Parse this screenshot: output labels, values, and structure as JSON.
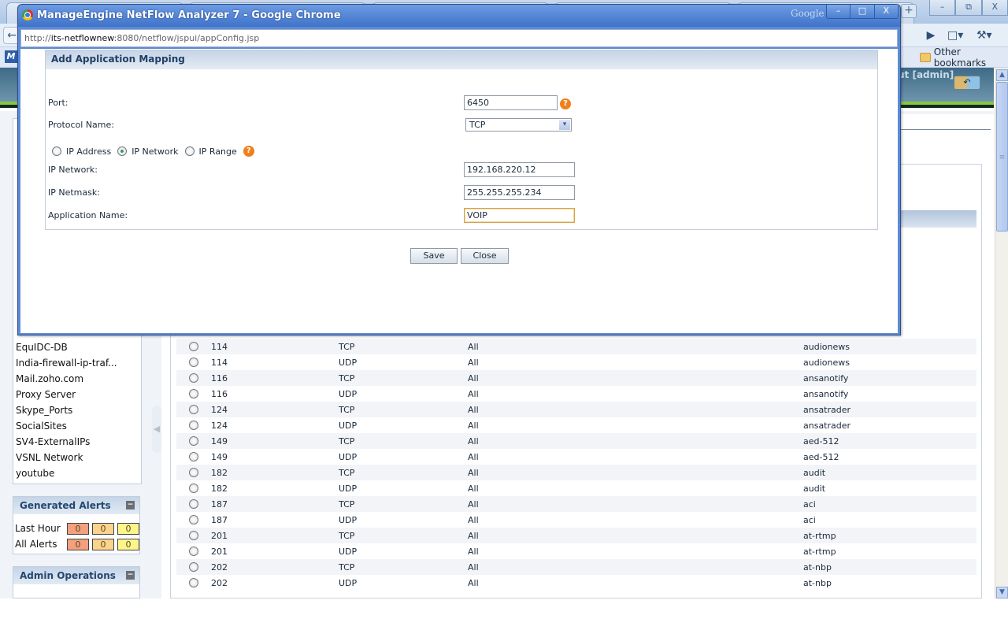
{
  "browser": {
    "other_bookmarks": "Other bookmarks",
    "new_tab_glyph": "+",
    "back_glyph": "←",
    "go_glyph": "▶",
    "page_menu_glyph": "□▾",
    "wrench_glyph": "⚒▾",
    "window_buttons": [
      "–",
      "⧉",
      "X"
    ],
    "m_logo": "M"
  },
  "app": {
    "user_label": "ut [admin]",
    "logout_glyph": "↶",
    "left_list": [
      "EquIDC-DB",
      "India-firewall-ip-traf...",
      "Mail.zoho.com",
      "Proxy Server",
      "Skype_Ports",
      "SocialSites",
      "SV4-ExternalIPs",
      "VSNL Network",
      "youtube"
    ],
    "alerts_panel": {
      "title": "Generated Alerts",
      "rows": [
        {
          "label": "Last Hour",
          "critical": "0",
          "major": "0",
          "warning": "0"
        },
        {
          "label": "All Alerts",
          "critical": "0",
          "major": "0",
          "warning": "0"
        }
      ]
    },
    "admin_panel": {
      "title": "Admin Operations"
    },
    "collapse_glyph": "−",
    "splitter_glyph": "◀",
    "alert_colors": {
      "critical": "#f4a07c",
      "major": "#fbd38a",
      "warning": "#fdf58a"
    },
    "rows": [
      {
        "port": "114",
        "protocol": "TCP",
        "ip": "All",
        "app": "audionews"
      },
      {
        "port": "114",
        "protocol": "UDP",
        "ip": "All",
        "app": "audionews"
      },
      {
        "port": "116",
        "protocol": "TCP",
        "ip": "All",
        "app": "ansanotify"
      },
      {
        "port": "116",
        "protocol": "UDP",
        "ip": "All",
        "app": "ansanotify"
      },
      {
        "port": "124",
        "protocol": "TCP",
        "ip": "All",
        "app": "ansatrader"
      },
      {
        "port": "124",
        "protocol": "UDP",
        "ip": "All",
        "app": "ansatrader"
      },
      {
        "port": "149",
        "protocol": "TCP",
        "ip": "All",
        "app": "aed-512"
      },
      {
        "port": "149",
        "protocol": "UDP",
        "ip": "All",
        "app": "aed-512"
      },
      {
        "port": "182",
        "protocol": "TCP",
        "ip": "All",
        "app": "audit"
      },
      {
        "port": "182",
        "protocol": "UDP",
        "ip": "All",
        "app": "audit"
      },
      {
        "port": "187",
        "protocol": "TCP",
        "ip": "All",
        "app": "aci"
      },
      {
        "port": "187",
        "protocol": "UDP",
        "ip": "All",
        "app": "aci"
      },
      {
        "port": "201",
        "protocol": "TCP",
        "ip": "All",
        "app": "at-rtmp"
      },
      {
        "port": "201",
        "protocol": "UDP",
        "ip": "All",
        "app": "at-rtmp"
      },
      {
        "port": "202",
        "protocol": "TCP",
        "ip": "All",
        "app": "at-nbp"
      },
      {
        "port": "202",
        "protocol": "UDP",
        "ip": "All",
        "app": "at-nbp"
      }
    ],
    "scroll_up": "▲",
    "scroll_down": "▼",
    "scroll_grip": "≡"
  },
  "popup": {
    "title": "ManageEngine NetFlow Analyzer 7 - Google Chrome",
    "google_mark": "Google",
    "window_buttons": [
      "–",
      "□",
      "X"
    ],
    "url_scheme": "http://",
    "url_host": "its-netflownew",
    "url_rest": ":8080/netflow/jspui/appConfig.jsp",
    "dialog": {
      "title": "Add Application Mapping",
      "port_label": "Port:",
      "port_value": "6450",
      "protocol_label": "Protocol Name:",
      "protocol_value": "TCP",
      "radio_options": [
        "IP Address",
        "IP Network",
        "IP Range"
      ],
      "radio_selected": "IP Network",
      "ip_network_label": "IP Network:",
      "ip_network_value": "192.168.220.12",
      "ip_netmask_label": "IP Netmask:",
      "ip_netmask_value": "255.255.255.234",
      "app_name_label": "Application Name:",
      "app_name_value": "VOIP",
      "help_glyph": "?",
      "dropdown_glyph": "▾"
    },
    "save_label": "Save",
    "close_label": "Close"
  }
}
